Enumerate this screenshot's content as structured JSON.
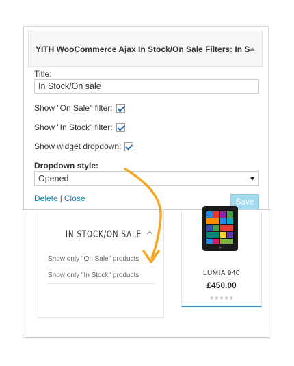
{
  "widget_form": {
    "header_title": "YITH WooCommerce Ajax In Stock/On Sale Filters: In St...",
    "title_label": "Title:",
    "title_value": "In Stock/On sale",
    "on_sale_label": "Show \"On Sale\" filter:",
    "on_sale_checked": true,
    "in_stock_label": "Show \"In Stock\" filter:",
    "in_stock_checked": true,
    "dropdown_label": "Show widget dropdown:",
    "dropdown_checked": true,
    "style_label": "Dropdown style:",
    "style_value": "Opened",
    "delete_label": "Delete",
    "separator": "|",
    "close_label": "Close",
    "save_label": "Save"
  },
  "preview": {
    "widget_title": "IN STOCK/ON SALE",
    "filters": [
      "Show only \"On Sale\" products",
      "Show only \"In Stock\" products"
    ],
    "product": {
      "name": "LUMIA 940",
      "price": "£450.00",
      "rating_stars": "★★★★★"
    }
  },
  "colors": {
    "link": "#1e7fb5",
    "save_button": "#a5dbef",
    "arrow": "#f5a623",
    "card_accent": "#2f8fbf"
  }
}
